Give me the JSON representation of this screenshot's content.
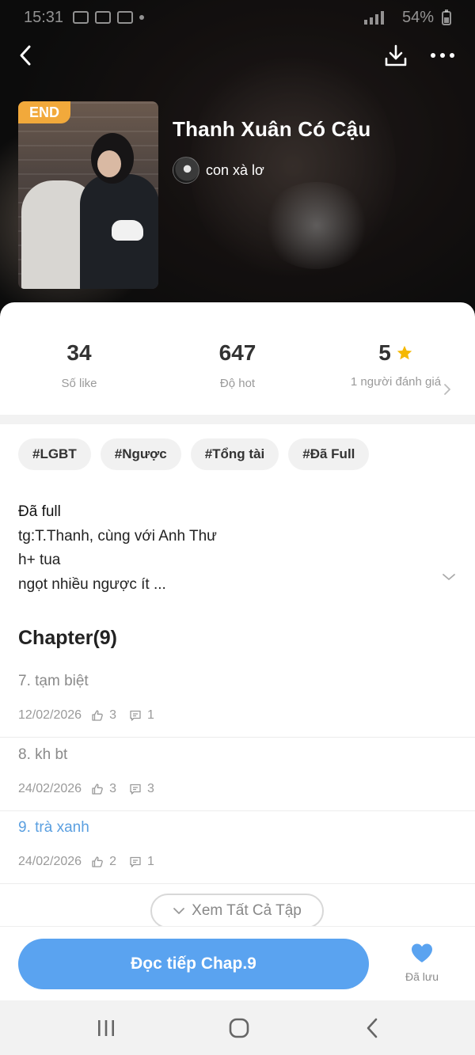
{
  "status_bar": {
    "time": "15:31",
    "battery": "54%"
  },
  "story": {
    "badge": "END",
    "title": "Thanh Xuân Có Cậu",
    "author": "con xà lơ"
  },
  "stats": {
    "likes": {
      "value": "34",
      "label": "Số like"
    },
    "hot": {
      "value": "647",
      "label": "Độ hot"
    },
    "rating": {
      "value": "5",
      "label": "1 người đánh giá"
    }
  },
  "tags": [
    "#LGBT",
    "#Ngược",
    "#Tổng tài",
    "#Đã Full"
  ],
  "description": [
    "Đã full",
    "tg:T.Thanh, cùng với Anh Thư",
    "h+ tua",
    "ngọt nhiều ngược ít ..."
  ],
  "chapters_section": {
    "heading": "Chapter(9)",
    "items": [
      {
        "title": "7. tạm biệt",
        "date": "12/02/2026",
        "likes": "3",
        "comments": "1",
        "current": false
      },
      {
        "title": "8. kh bt",
        "date": "24/02/2026",
        "likes": "3",
        "comments": "3",
        "current": false
      },
      {
        "title": "9. trà xanh",
        "date": "24/02/2026",
        "likes": "2",
        "comments": "1",
        "current": true
      }
    ],
    "see_all_label": "Xem Tất Cả Tập"
  },
  "actions": {
    "read_label": "Đọc tiếp Chap.9",
    "saved_label": "Đã lưu"
  },
  "colors": {
    "accent": "#5aa3f0",
    "badge": "#f2a93b",
    "star": "#f5b800",
    "current_chapter": "#5a9fe0"
  }
}
